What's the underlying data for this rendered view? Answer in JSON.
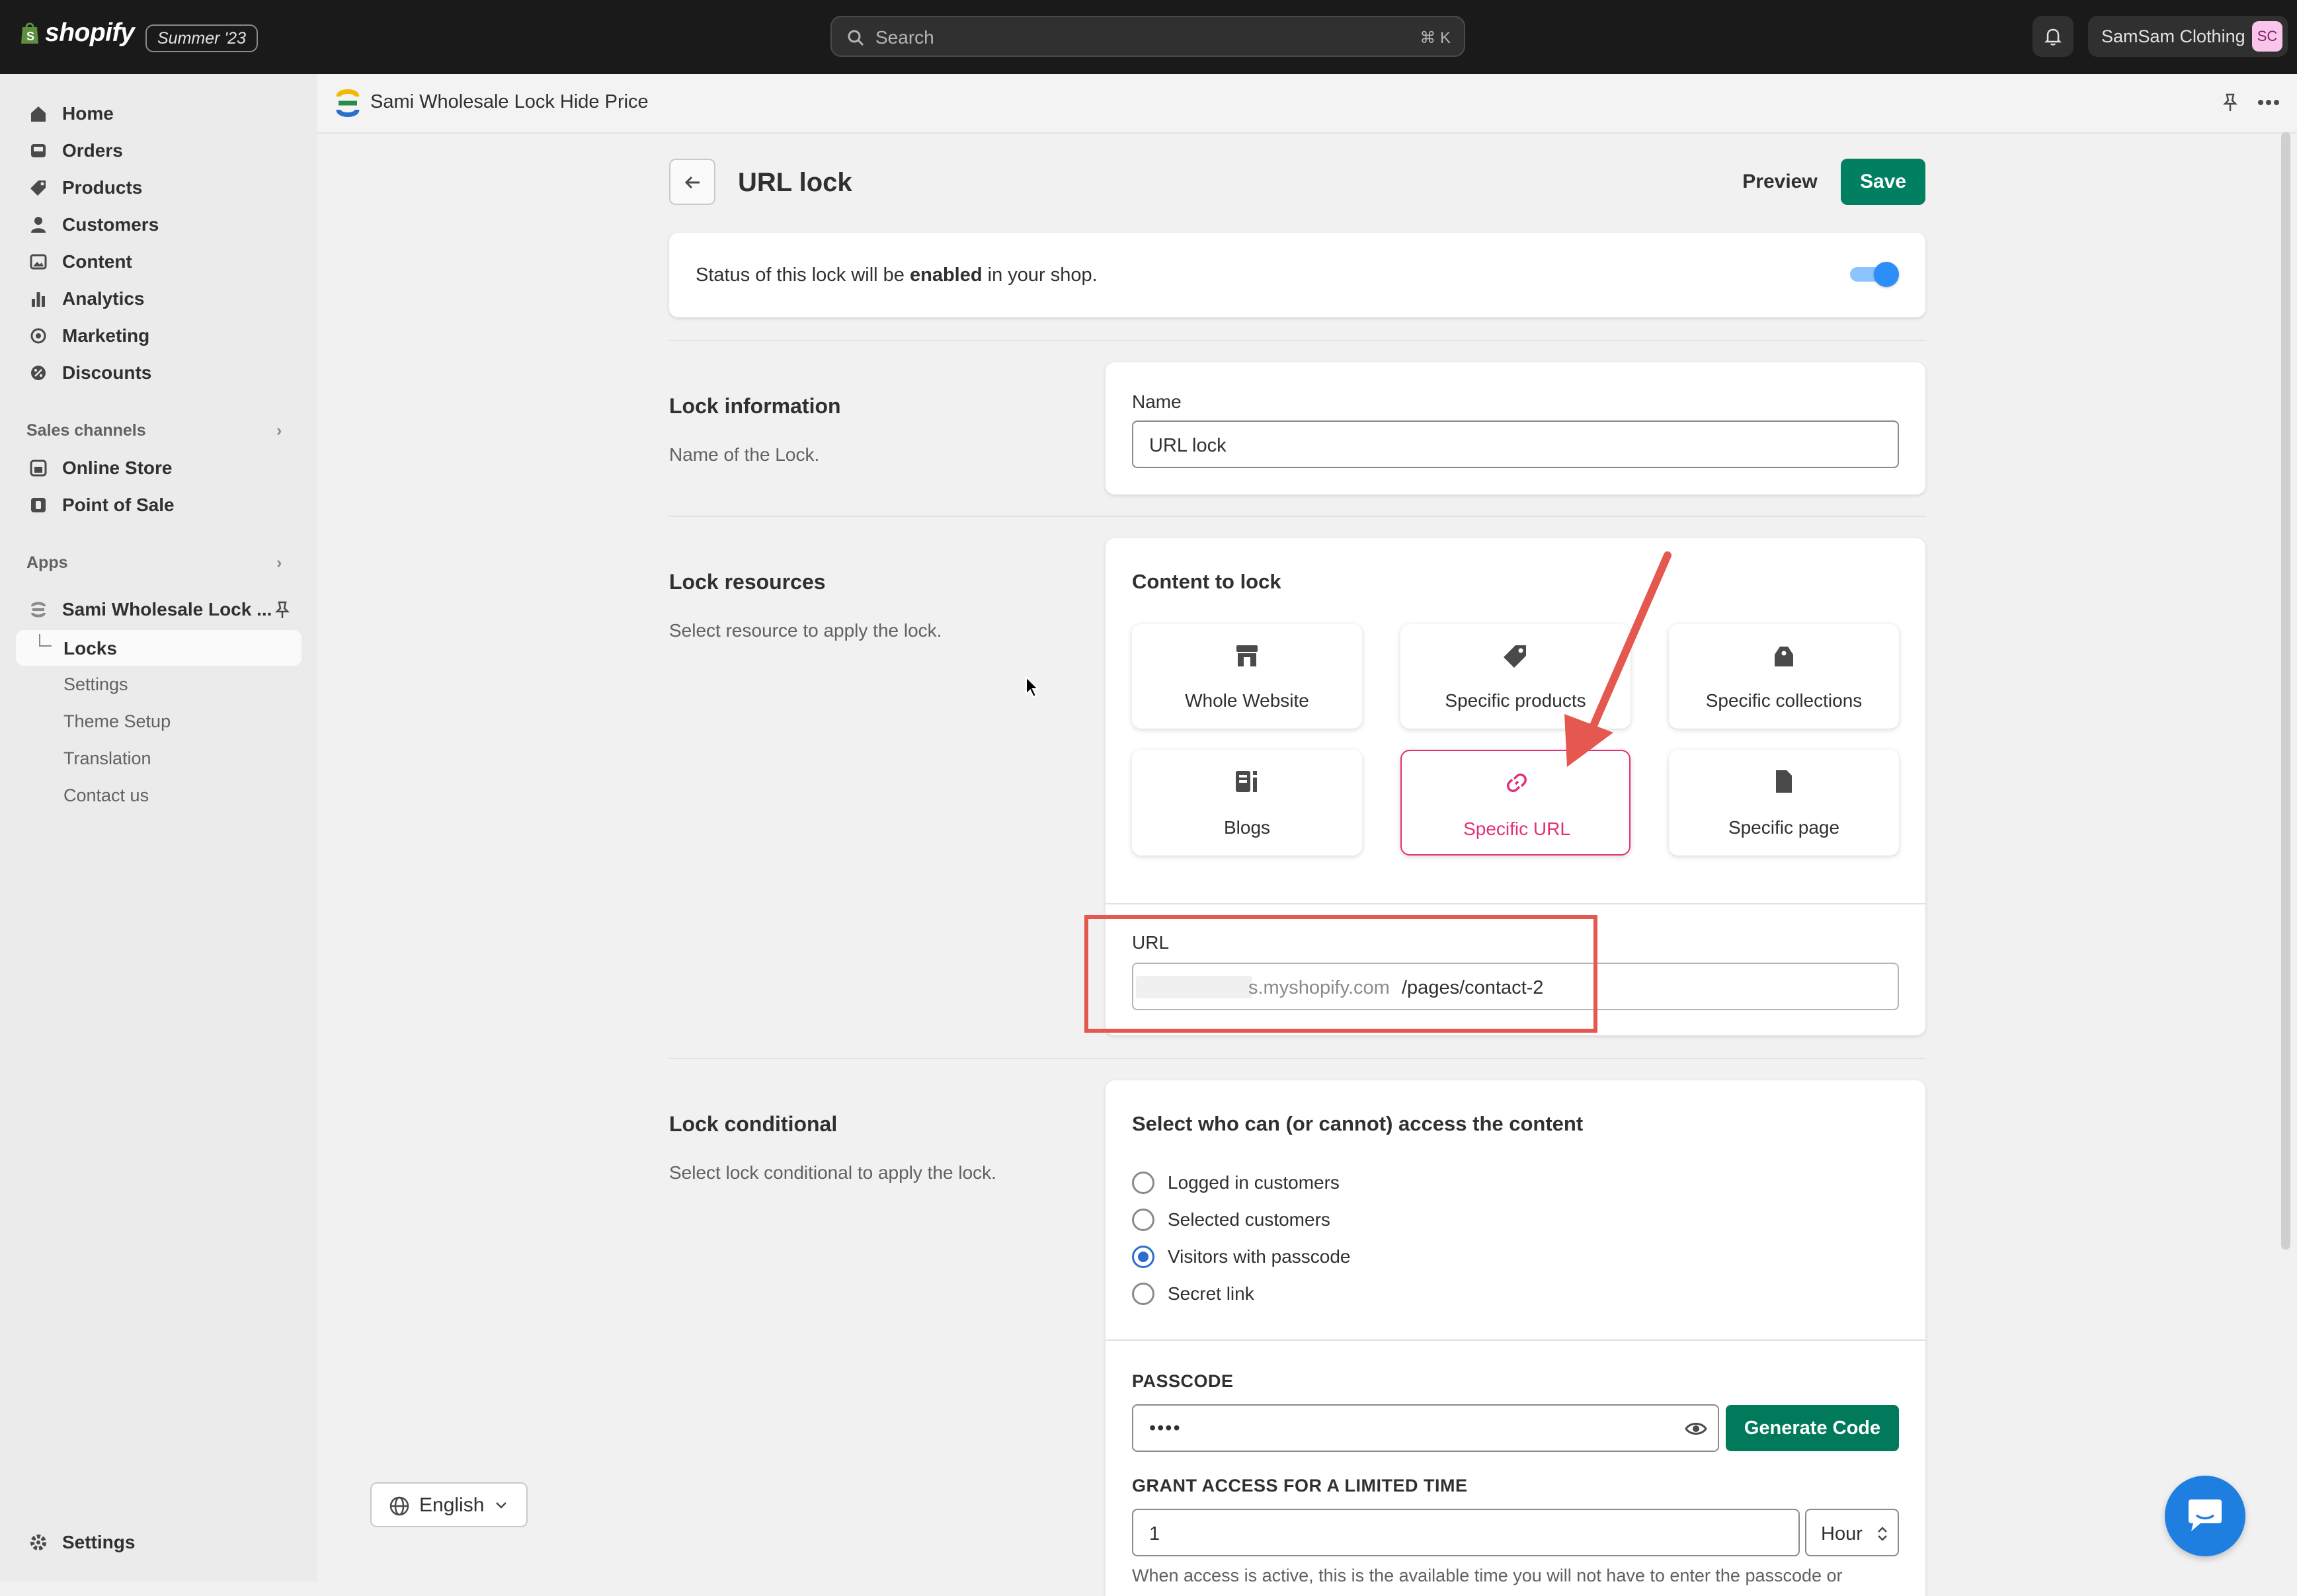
{
  "topbar": {
    "brand": "shopify",
    "edition_badge": "Summer '23",
    "search_placeholder": "Search",
    "search_shortcut": "⌘ K",
    "store_name": "SamSam Clothing",
    "store_initials": "SC"
  },
  "sidebar": {
    "items": [
      {
        "label": "Home",
        "icon": "home-icon"
      },
      {
        "label": "Orders",
        "icon": "inbox-icon"
      },
      {
        "label": "Products",
        "icon": "tag-icon"
      },
      {
        "label": "Customers",
        "icon": "person-icon"
      },
      {
        "label": "Content",
        "icon": "image-icon"
      },
      {
        "label": "Analytics",
        "icon": "bar-chart-icon"
      },
      {
        "label": "Marketing",
        "icon": "target-icon"
      },
      {
        "label": "Discounts",
        "icon": "discount-icon"
      }
    ],
    "sales_channels_label": "Sales channels",
    "sales_channels": [
      {
        "label": "Online Store",
        "icon": "store-icon"
      },
      {
        "label": "Point of Sale",
        "icon": "pos-icon"
      }
    ],
    "apps_label": "Apps",
    "app_name": "Sami Wholesale Lock ...",
    "app_sub": [
      "Locks",
      "Settings",
      "Theme Setup",
      "Translation",
      "Contact us"
    ],
    "settings_label": "Settings",
    "language": "English"
  },
  "app_header": {
    "title": "Sami Wholesale Lock Hide Price"
  },
  "page": {
    "title": "URL lock",
    "preview_label": "Preview",
    "save_label": "Save",
    "status_prefix": "Status of this lock will be ",
    "status_bold": "enabled",
    "status_suffix": " in your shop.",
    "status_enabled": true
  },
  "lock_information": {
    "title": "Lock information",
    "description": "Name of the Lock.",
    "name_label": "Name",
    "name_value": "URL lock"
  },
  "lock_resources": {
    "title": "Lock resources",
    "description": "Select resource to apply the lock.",
    "content_label": "Content to lock",
    "options": [
      {
        "label": "Whole Website",
        "icon": "storefront-icon",
        "selected": false
      },
      {
        "label": "Specific products",
        "icon": "tag-icon",
        "selected": false
      },
      {
        "label": "Specific collections",
        "icon": "collection-icon",
        "selected": false
      },
      {
        "label": "Blogs",
        "icon": "blog-icon",
        "selected": false
      },
      {
        "label": "Specific URL",
        "icon": "link-icon",
        "selected": true
      },
      {
        "label": "Specific page",
        "icon": "page-icon",
        "selected": false
      }
    ],
    "url_label": "URL",
    "url_domain": "s.myshopify.com",
    "url_path": "/pages/contact-2"
  },
  "lock_conditional": {
    "title": "Lock conditional",
    "description": "Select lock conditional to apply the lock.",
    "access_label": "Select who can (or cannot) access the content",
    "options": [
      {
        "label": "Logged in customers",
        "selected": false
      },
      {
        "label": "Selected customers",
        "selected": false
      },
      {
        "label": "Visitors with passcode",
        "selected": true
      },
      {
        "label": "Secret link",
        "selected": false
      }
    ],
    "passcode_label": "PASSCODE",
    "passcode_value": "••••",
    "generate_label": "Generate Code",
    "grant_label": "GRANT ACCESS FOR A LIMITED TIME",
    "grant_value": "1",
    "grant_unit": "Hour",
    "help_text": "When access is active, this is the available time you will not have to enter the passcode or"
  },
  "colors": {
    "accent_green": "#008060",
    "selected_pink": "#e4307a",
    "annotation_red": "#e5584f",
    "toggle_blue": "#2c8ef8"
  }
}
